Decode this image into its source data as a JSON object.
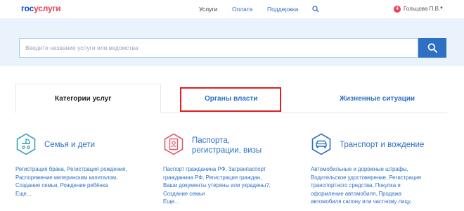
{
  "header": {
    "logo_part1": "гос",
    "logo_part2": "услуги",
    "nav": [
      "Услуги",
      "Оплата",
      "Поддержка"
    ],
    "notif_count": "4",
    "user_name": "Гольцова П.В.",
    "caret": "▼"
  },
  "search": {
    "placeholder": "Введите название услуги или ведомства"
  },
  "tabs": [
    {
      "label": "Категории услуг"
    },
    {
      "label": "Органы власти"
    },
    {
      "label": "Жизненные ситуации"
    }
  ],
  "categories": [
    {
      "title": "Семья и дети",
      "lines": [
        "Регистрация брака, Регистрация рождения,",
        "Распоряжение материнским капиталом,",
        "Создание семьи, Рождение ребёнка",
        "Еще..."
      ]
    },
    {
      "title_line1": "Паспорта,",
      "title_line2": "регистрации, визы",
      "lines": [
        "Паспорт гражданина РФ, Загранпаспорт",
        "гражданина РФ, Регистрация граждан,",
        "Ваши документы утеряны или украдены?,",
        "Создание семьи",
        "Еще..."
      ]
    },
    {
      "title": "Транспорт и вождение",
      "lines": [
        "Автомобильные и дорожные штрафы,",
        "Водительское удостоверение, Регистрация",
        "транспортного средства, Покупка и",
        "оформление автомобиля, Продажа",
        "автомобиля салону или частному лицу,"
      ]
    }
  ],
  "colors": {
    "brand_blue": "#0d4cd3",
    "brand_red": "#ee3f58",
    "link_blue": "#2d70c4",
    "banner_bg": "#eaf3fb",
    "icon_teal": "#3aa6b9",
    "icon_red": "#e05a6e",
    "icon_blue": "#2d70c4",
    "highlight_red": "#e02020"
  }
}
